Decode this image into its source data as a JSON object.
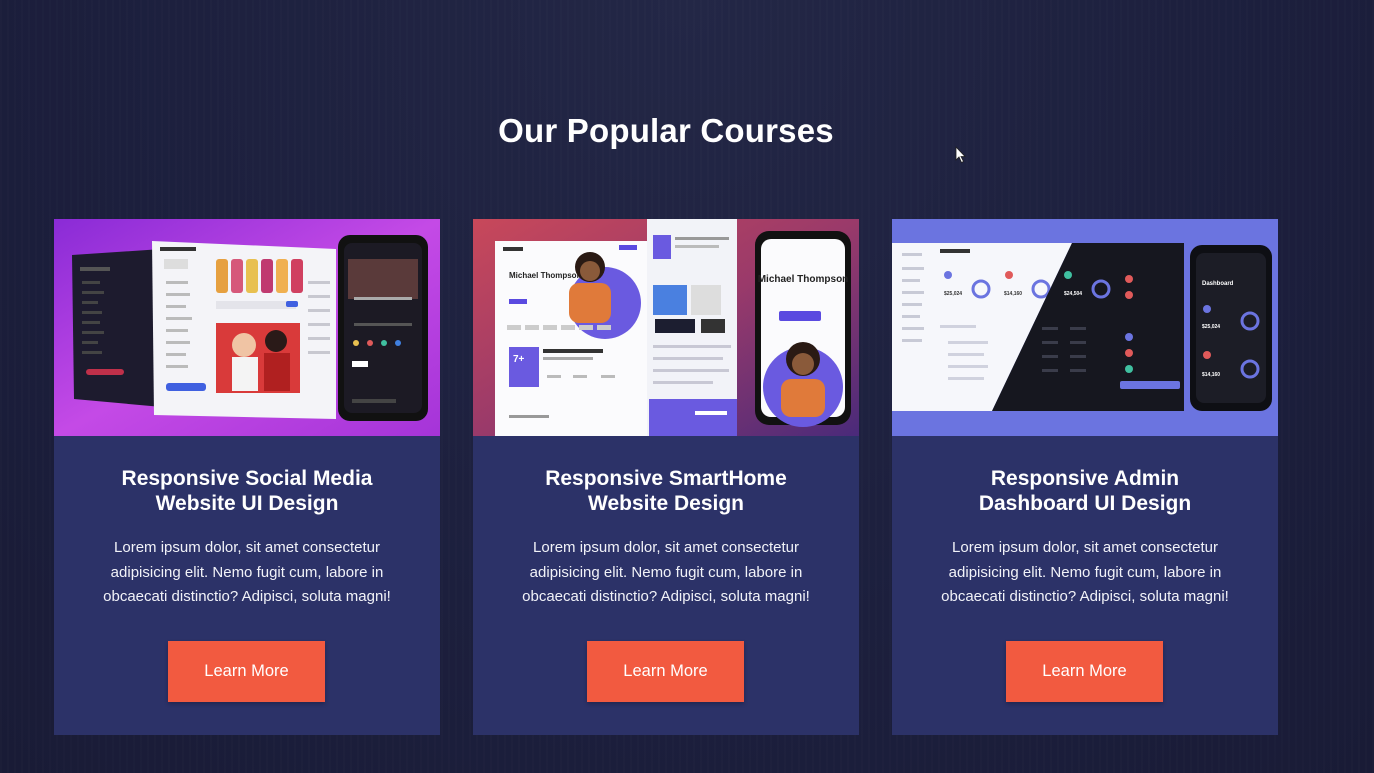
{
  "section": {
    "title": "Our Popular Courses"
  },
  "courses": [
    {
      "title_lines": [
        "Responsive Social Media",
        "Website UI Design"
      ],
      "description_lines": [
        "Lorem ipsum dolor, sit amet consectetur",
        "adipisicing elit. Nemo fugit cum, labore in",
        "obcaecati distinctio? Adipisci, soluta magni!"
      ],
      "button_label": "Learn More",
      "thumbnail": {
        "icon": "social-media-mockup-image",
        "accent": "#c040e0"
      }
    },
    {
      "title_lines": [
        "Responsive SmartHome",
        "Website Design"
      ],
      "description_lines": [
        "Lorem ipsum dolor, sit amet consectetur",
        "adipisicing elit. Nemo fugit cum, labore in",
        "obcaecati distinctio? Adipisci, soluta magni!"
      ],
      "button_label": "Learn More",
      "thumbnail": {
        "icon": "smarthome-mockup-image",
        "accent": "#6a5ae0",
        "name_text": "Michael Thompson",
        "stat_text": "7+"
      }
    },
    {
      "title_lines": [
        "Responsive Admin",
        "Dashboard UI Design"
      ],
      "description_lines": [
        "Lorem ipsum dolor, sit amet consectetur",
        "adipisicing elit. Nemo fugit cum, labore in",
        "obcaecati distinctio? Adipisci, soluta magni!"
      ],
      "button_label": "Learn More",
      "thumbnail": {
        "icon": "admin-dashboard-mockup-image",
        "accent": "#6b74e0",
        "heading_text": "Dashboard",
        "stat_a": "$25,024",
        "stat_b": "$14,160",
        "stat_c": "$24,504"
      }
    }
  ],
  "colors": {
    "page_bg": "#1d2040",
    "card_bg": "#2c3268",
    "button_bg": "#f25a40"
  }
}
